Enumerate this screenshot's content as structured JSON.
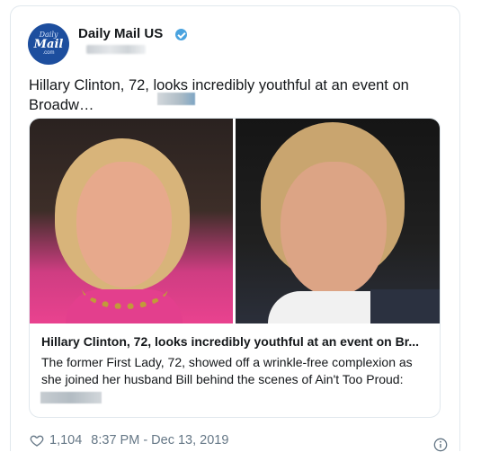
{
  "account": {
    "avatar_line1": "Daily",
    "avatar_line2": "Mail",
    "avatar_line3": ".com",
    "name": "Daily Mail US"
  },
  "tweet": {
    "text": "Hillary Clinton, 72, looks incredibly youthful at an event on Broadw…"
  },
  "card": {
    "title": "Hillary Clinton, 72, looks incredibly youthful at an event on Br...",
    "description": "The former First Lady, 72, showed off a wrinkle-free complexion as she joined her husband Bill behind the scenes of Ain't Too Proud:"
  },
  "footer": {
    "likes": "1,104",
    "timestamp": "8:37 PM - Dec 13, 2019"
  },
  "icons": {
    "verified": "verified-badge-icon",
    "like": "heart-icon",
    "info": "info-icon"
  },
  "colors": {
    "avatar_bg": "#1d4e9e",
    "verified": "#4aa3df",
    "muted_text": "#657786",
    "border": "#e1e8ed"
  }
}
